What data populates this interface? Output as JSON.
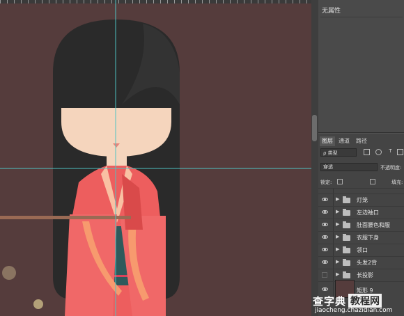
{
  "properties": {
    "title": "无属性"
  },
  "layers_panel": {
    "tabs": [
      "图层",
      "通道",
      "路径"
    ],
    "filter": "ρ 类型",
    "blend_mode": "穿透",
    "opacity_label": "不透明度:",
    "lock_label": "锁定:",
    "fill_label": "填充:",
    "layers": [
      {
        "name": "灯笼",
        "type": "group",
        "visible": true
      },
      {
        "name": "左边袖口",
        "type": "group",
        "visible": true
      },
      {
        "name": "肚面腰色和服",
        "type": "group",
        "visible": true
      },
      {
        "name": "衣服下身",
        "type": "group",
        "visible": true
      },
      {
        "name": "领口",
        "type": "group",
        "visible": true
      },
      {
        "name": "头发2背",
        "type": "group",
        "visible": true
      },
      {
        "name": "长投影",
        "type": "group",
        "visible": false
      },
      {
        "name": "矩形 9",
        "type": "shape",
        "visible": true
      }
    ]
  },
  "watermark": {
    "brand": "查字典",
    "suffix": "教程网",
    "url": "jiaocheng.chazidian.com"
  },
  "colors": {
    "canvas_bg": "#553c3c",
    "hair": "#2a2a2a",
    "skin": "#f5d5bd",
    "kimono": "#ed5e5e",
    "sash": "#2e5a5c",
    "guide": "#4fc3c3"
  }
}
